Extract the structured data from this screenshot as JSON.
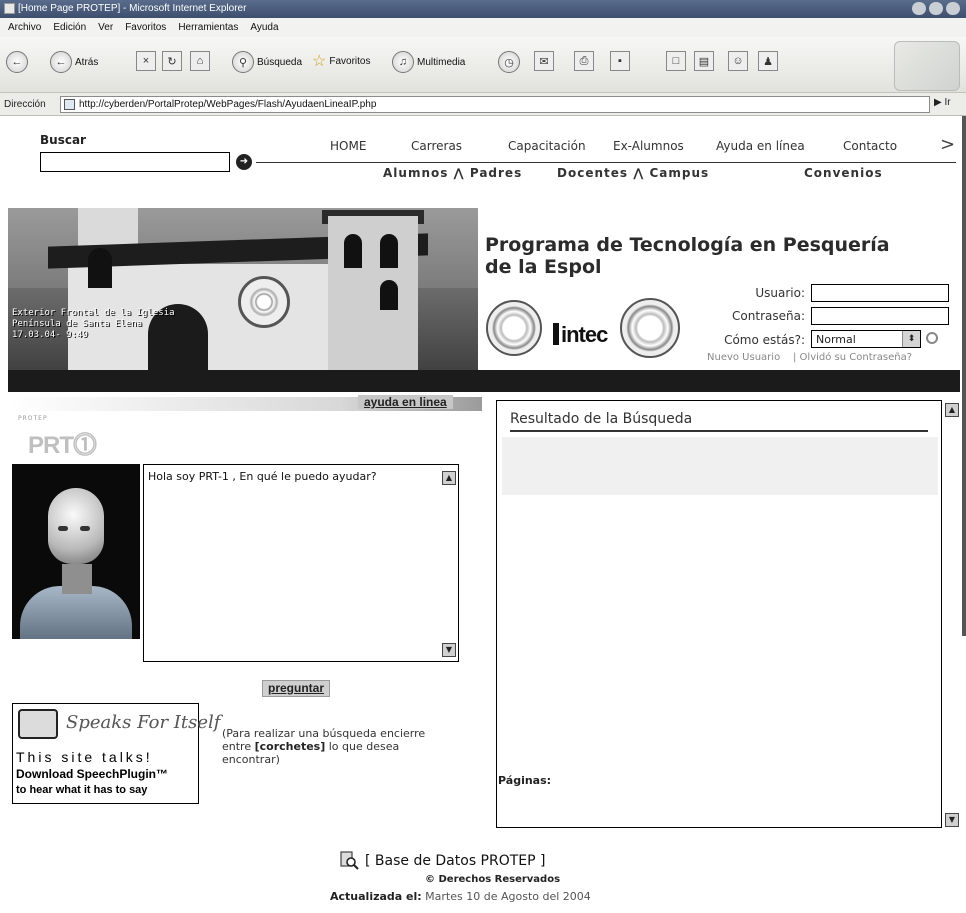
{
  "browser": {
    "title": "[Home Page PROTEP] - Microsoft Internet Explorer",
    "menu": [
      "Archivo",
      "Edición",
      "Ver",
      "Favoritos",
      "Herramientas",
      "Ayuda"
    ],
    "toolbar": {
      "back": "Atrás",
      "search": "Búsqueda",
      "favorites": "Favoritos",
      "multimedia": "Multimedia"
    },
    "address_label": "Dirección",
    "address_url": "http://cyberden/PortalProtep/WebPages/Flash/AyudaenLineaIP.php",
    "go_label": "Ir"
  },
  "search": {
    "label": "Buscar"
  },
  "topnav": [
    "HOME",
    "Carreras",
    "Capacitación",
    "Ex-Alumnos",
    "Ayuda en línea",
    "Contacto"
  ],
  "subnav": {
    "alumnos_padres": "Alumnos ⋀ Padres",
    "docentes_campus": "Docentes ⋀ Campus",
    "convenios": "Convenios"
  },
  "banner": {
    "caption_line1": "Exterior Frontal de la Iglesia",
    "caption_line2": "Península de Santa Elena",
    "caption_line3": "17.03.04- 9:49"
  },
  "program": {
    "title": "Programa de Tecnología en Pesquería de la Espol",
    "intec": "intec"
  },
  "login": {
    "user_label": "Usuario:",
    "password_label": "Contraseña:",
    "status_label": "Cómo estás?:",
    "status_value": "Normal",
    "new_user": "Nuevo Usuario",
    "forgot": "| Olvidó su Contraseña?"
  },
  "help": {
    "title": "ayuda en linea",
    "logo_small": "PROTEP",
    "logo": "PRT",
    "chat_text": "Hola soy PRT-1 , En qué le puedo ayudar?",
    "ask_button": "preguntar",
    "speak_title": "Speaks For Itself",
    "speak_line1": "This site talks!",
    "speak_line2": "Download SpeechPlugin™",
    "speak_line3": "to hear what it has to say",
    "hint_prefix": "(Para realizar una búsqueda encierre entre",
    "hint_bold": "[corchetes]",
    "hint_suffix": "lo que desea encontrar)"
  },
  "results": {
    "title": "Resultado de la Búsqueda",
    "pages_label": "Páginas:"
  },
  "footer": {
    "title": "[ Base de Datos PROTEP ]",
    "copyright": "© Derechos Reservados",
    "updated_label": "Actualizada el:",
    "updated_value": "Martes 10 de Agosto del 2004"
  }
}
